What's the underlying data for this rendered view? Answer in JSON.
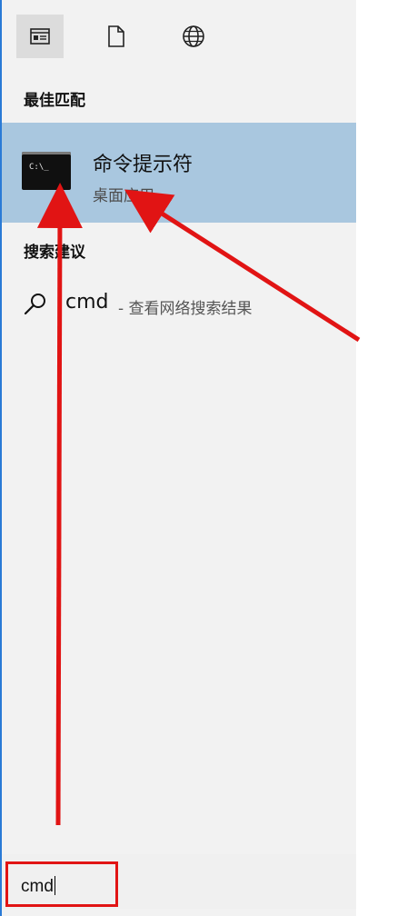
{
  "header": {
    "tabs": [
      {
        "name": "apps-icon"
      },
      {
        "name": "documents-icon"
      },
      {
        "name": "web-icon"
      }
    ]
  },
  "best_match": {
    "section_label": "最佳匹配",
    "title": "命令提示符",
    "subtitle": "桌面应用",
    "icon_text": "C:\\_"
  },
  "search_suggestions": {
    "section_label": "搜索建议",
    "items": [
      {
        "term": "cmd",
        "hint": "- 查看网络搜索结果"
      }
    ]
  },
  "search_box": {
    "value": "cmd"
  },
  "colors": {
    "selection": "#a9c7df",
    "annotation": "#e11414",
    "panel_bg": "#f2f2f2"
  }
}
